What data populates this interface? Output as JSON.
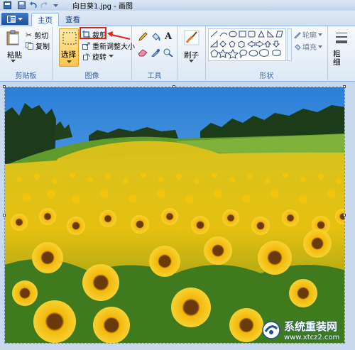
{
  "window": {
    "title": "向日葵1.jpg - 画图"
  },
  "tabs": [
    {
      "label": "主页",
      "active": true
    },
    {
      "label": "查看",
      "active": false
    }
  ],
  "ribbon": {
    "clipboard": {
      "paste": "粘贴",
      "cut": "剪切",
      "copy": "复制",
      "group": "剪贴板"
    },
    "image": {
      "select": "选择",
      "crop": "裁剪",
      "resize": "重新调整大小",
      "rotate": "旋转",
      "group": "图像"
    },
    "tools": {
      "group": "工具"
    },
    "brushes": {
      "label": "刷子"
    },
    "shapes": {
      "outline": "轮廓",
      "fill": "填充",
      "group": "形状"
    },
    "size": {
      "label": "粗细"
    }
  },
  "watermark": {
    "name": "系统重装网",
    "url": "www.xtcz2.com"
  },
  "colors": {
    "accent": "#1d4f9c",
    "highlight": "#e0241c",
    "select_active": "#fbc54f"
  }
}
